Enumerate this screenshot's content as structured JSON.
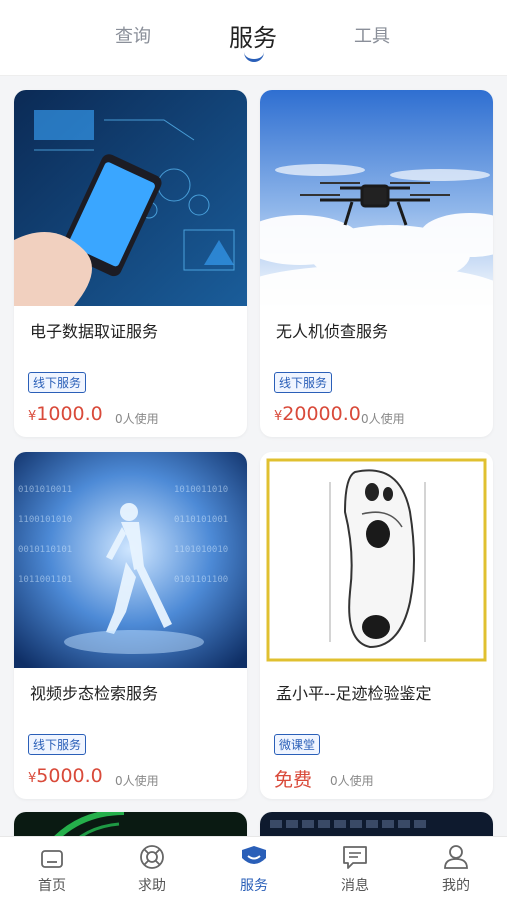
{
  "top_tabs": {
    "query": "查询",
    "service": "服务",
    "tools": "工具"
  },
  "cards": [
    {
      "title": "电子数据取证服务",
      "tag": "线下服务",
      "currency": "¥",
      "price": "1000.0",
      "users": "0人使用"
    },
    {
      "title": "无人机侦查服务",
      "tag": "线下服务",
      "currency": "¥",
      "price": "20000.0",
      "users": "0人使用"
    },
    {
      "title": "视频步态检索服务",
      "tag": "线下服务",
      "currency": "¥",
      "price": "5000.0",
      "users": "0人使用"
    },
    {
      "title": "孟小平--足迹检验鉴定",
      "tag": "微课堂",
      "price": "免费",
      "users": "0人使用"
    }
  ],
  "bottom_nav": {
    "home": "首页",
    "help": "求助",
    "service": "服务",
    "messages": "消息",
    "mine": "我的"
  },
  "colors": {
    "accent": "#2a5fb8",
    "price": "#d94a3a"
  }
}
